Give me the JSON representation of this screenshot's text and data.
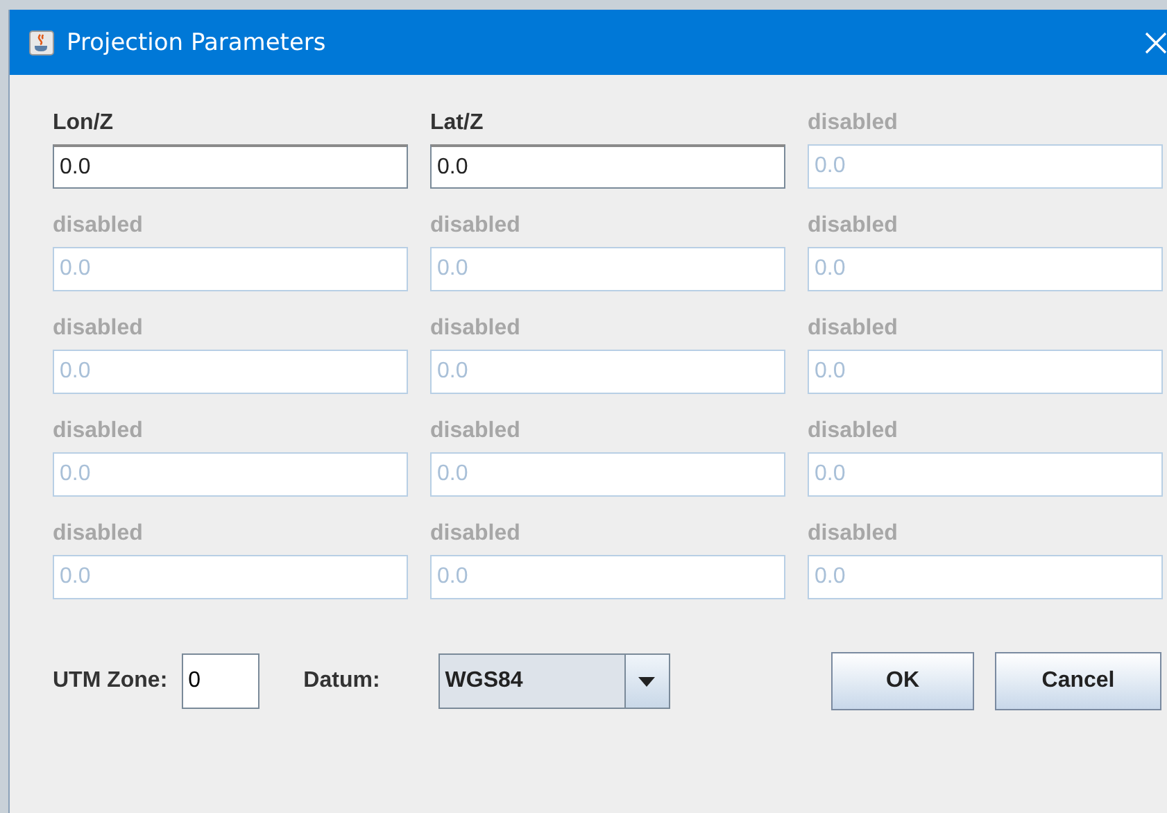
{
  "window": {
    "title": "Projection Parameters"
  },
  "parameters": [
    {
      "label": "Lon/Z",
      "value": "0.0",
      "disabled": false
    },
    {
      "label": "Lat/Z",
      "value": "0.0",
      "disabled": false
    },
    {
      "label": "disabled",
      "value": "0.0",
      "disabled": true
    },
    {
      "label": "disabled",
      "value": "0.0",
      "disabled": true
    },
    {
      "label": "disabled",
      "value": "0.0",
      "disabled": true
    },
    {
      "label": "disabled",
      "value": "0.0",
      "disabled": true
    },
    {
      "label": "disabled",
      "value": "0.0",
      "disabled": true
    },
    {
      "label": "disabled",
      "value": "0.0",
      "disabled": true
    },
    {
      "label": "disabled",
      "value": "0.0",
      "disabled": true
    },
    {
      "label": "disabled",
      "value": "0.0",
      "disabled": true
    },
    {
      "label": "disabled",
      "value": "0.0",
      "disabled": true
    },
    {
      "label": "disabled",
      "value": "0.0",
      "disabled": true
    },
    {
      "label": "disabled",
      "value": "0.0",
      "disabled": true
    },
    {
      "label": "disabled",
      "value": "0.0",
      "disabled": true
    },
    {
      "label": "disabled",
      "value": "0.0",
      "disabled": true
    }
  ],
  "utm_zone": {
    "label": "UTM Zone:",
    "value": "0"
  },
  "datum": {
    "label": "Datum:",
    "value": "WGS84"
  },
  "buttons": [
    "OK",
    "Cancel"
  ]
}
